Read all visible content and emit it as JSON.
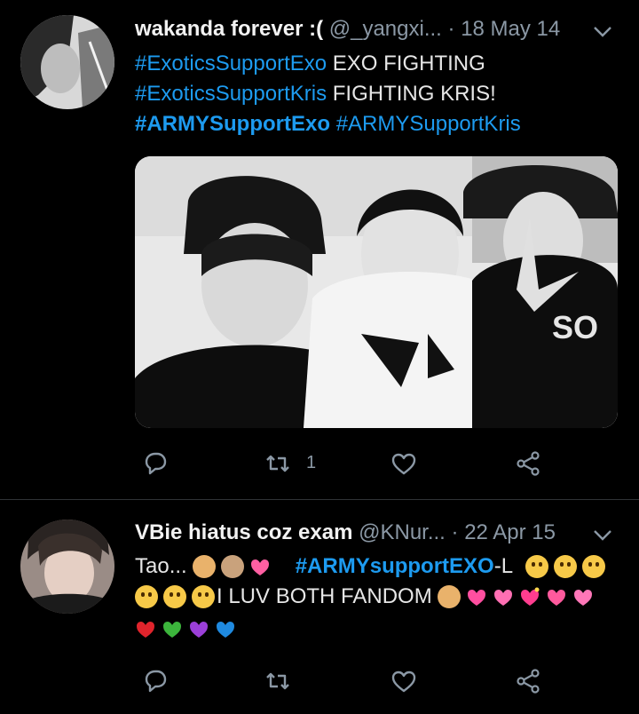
{
  "tweet1": {
    "name": "wakanda forever :(",
    "handle": "@_yangxi...",
    "date": "18 May 14",
    "lines": [
      [
        {
          "t": "#ExoticsSupportExo",
          "c": "tag"
        },
        {
          "t": " EXO FIGHTING",
          "c": ""
        }
      ],
      [
        {
          "t": "#ExoticsSupportKris",
          "c": "tag"
        },
        {
          "t": " FIGHTING KRIS!",
          "c": ""
        }
      ],
      [
        {
          "t": "#ARMYSupportExo",
          "c": "tag bold"
        },
        {
          "t": "  ",
          "c": ""
        },
        {
          "t": "#ARMYSupportKris",
          "c": "tag"
        }
      ]
    ],
    "photo_text": "SO",
    "retweet_count": "1"
  },
  "tweet2": {
    "name": "VBie hiatus coz exam",
    "handle": "@KNur...",
    "date": "22 Apr 15",
    "line1_prefix": "Tao...",
    "line1_tag": "#ARMYsupportEXO",
    "line1_suffix": "-L",
    "line2_text": "I LUV BOTH FANDOM"
  },
  "colors": {
    "accent": "#1d9bf0",
    "background": "#000000",
    "muted": "#8b98a5"
  },
  "icons": [
    "reply-icon",
    "retweet-icon",
    "like-icon",
    "share-icon",
    "chevron-down-icon"
  ]
}
